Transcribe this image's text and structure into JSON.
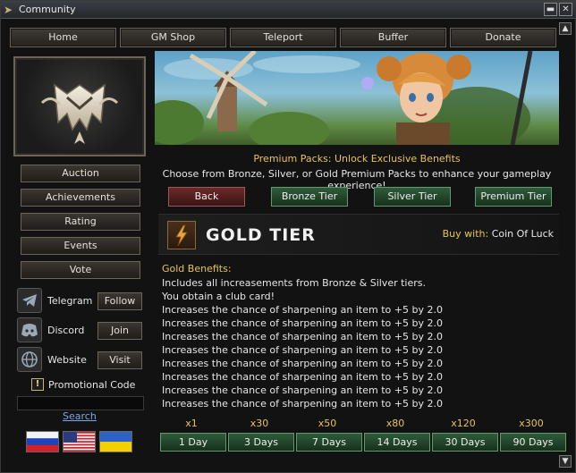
{
  "window": {
    "title": "Community"
  },
  "nav": [
    "Home",
    "GM Shop",
    "Teleport",
    "Buffer",
    "Donate"
  ],
  "sidebar": {
    "menu": [
      "Auction",
      "Achievements",
      "Rating",
      "Events",
      "Vote"
    ],
    "social": [
      {
        "name": "Telegram",
        "action": "Follow",
        "icon": "telegram-icon"
      },
      {
        "name": "Discord",
        "action": "Join",
        "icon": "discord-icon"
      },
      {
        "name": "Website",
        "action": "Visit",
        "icon": "globe-icon"
      }
    ],
    "promo_label": "Promotional Code",
    "search_label": "Search"
  },
  "main": {
    "premium_title": "Premium Packs: Unlock Exclusive Benefits",
    "premium_sub": "Choose from Bronze, Silver, or Gold Premium Packs to enhance your gameplay experience!",
    "tier_buttons": [
      "Back",
      "Bronze Tier",
      "Silver Tier",
      "Premium Tier"
    ],
    "gold_title": "GOLD TIER",
    "buy_with_label": "Buy with:",
    "buy_with_value": "Coin Of Luck",
    "benefits_title": "Gold Benefits:",
    "benefits": [
      "Includes all increasements from Bronze & Silver tiers.",
      "You obtain a club card!",
      "Increases the chance of sharpening an item to +5 by 2.0",
      "Increases the chance of sharpening an item to +5 by 2.0",
      "Increases the chance of sharpening an item to +5 by 2.0",
      "Increases the chance of sharpening an item to +5 by 2.0",
      "Increases the chance of sharpening an item to +5 by 2.0",
      "Increases the chance of sharpening an item to +5 by 2.0",
      "Increases the chance of sharpening an item to +5 by 2.0",
      "Increases the chance of sharpening an item to +5 by 2.0"
    ],
    "durations": [
      {
        "mult": "x1",
        "label": "1 Day"
      },
      {
        "mult": "x30",
        "label": "3 Days"
      },
      {
        "mult": "x50",
        "label": "7 Days"
      },
      {
        "mult": "x80",
        "label": "14 Days"
      },
      {
        "mult": "x120",
        "label": "30 Days"
      },
      {
        "mult": "x300",
        "label": "90 Days"
      }
    ]
  },
  "colors": {
    "accent_gold": "#e7c45b",
    "green_button": "#2f5c3a",
    "back_button": "#6b2a2a",
    "link": "#7ba7e8"
  }
}
